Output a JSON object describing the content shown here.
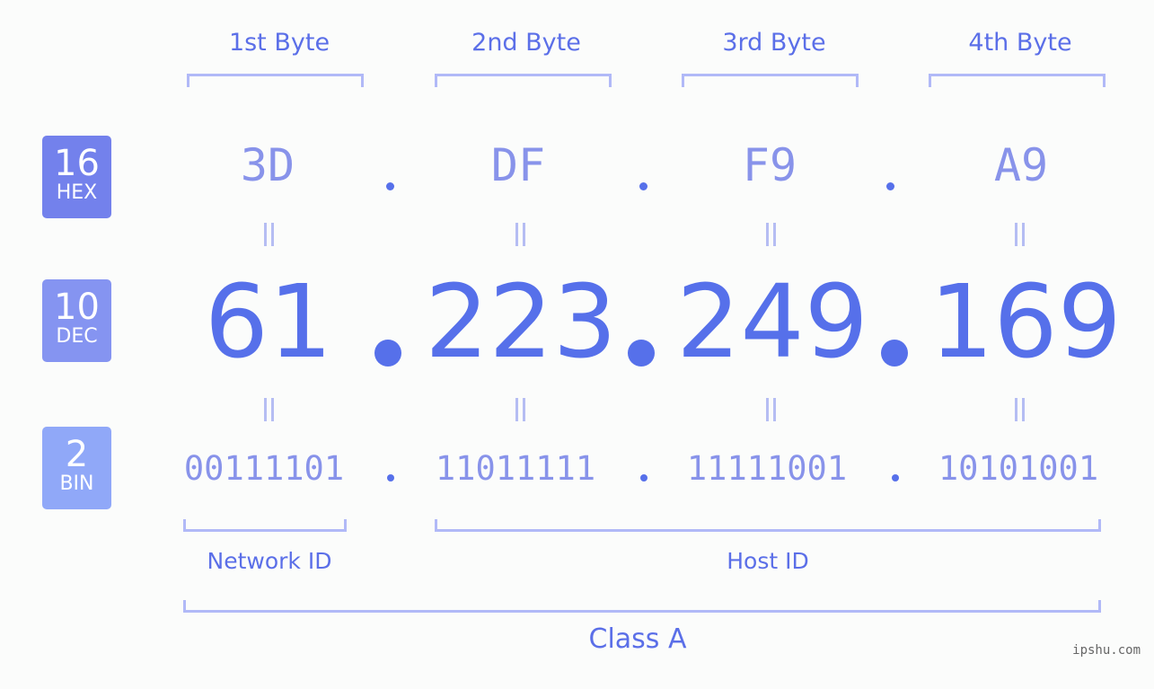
{
  "bytes": [
    {
      "label": "1st Byte",
      "hex": "3D",
      "dec": "61",
      "bin": "00111101"
    },
    {
      "label": "2nd Byte",
      "hex": "DF",
      "dec": "223",
      "bin": "11011111"
    },
    {
      "label": "3rd Byte",
      "hex": "F9",
      "dec": "249",
      "bin": "11111001"
    },
    {
      "label": "4th Byte",
      "hex": "A9",
      "dec": "169",
      "bin": "10101001"
    }
  ],
  "badges": {
    "hex": {
      "num": "16",
      "label": "HEX",
      "color": "#7381ec"
    },
    "dec": {
      "num": "10",
      "label": "DEC",
      "color": "#8594f1"
    },
    "bin": {
      "num": "2",
      "label": "BIN",
      "color": "#90a8f8"
    }
  },
  "separator": ".",
  "network_id_label": "Network ID",
  "host_id_label": "Host ID",
  "class_label": "Class A",
  "watermark": "ipshu.com",
  "colors": {
    "accent": "#5670ea",
    "light_accent": "#8893ea",
    "bracket": "#b1b9f7",
    "background": "#fbfcfb"
  }
}
